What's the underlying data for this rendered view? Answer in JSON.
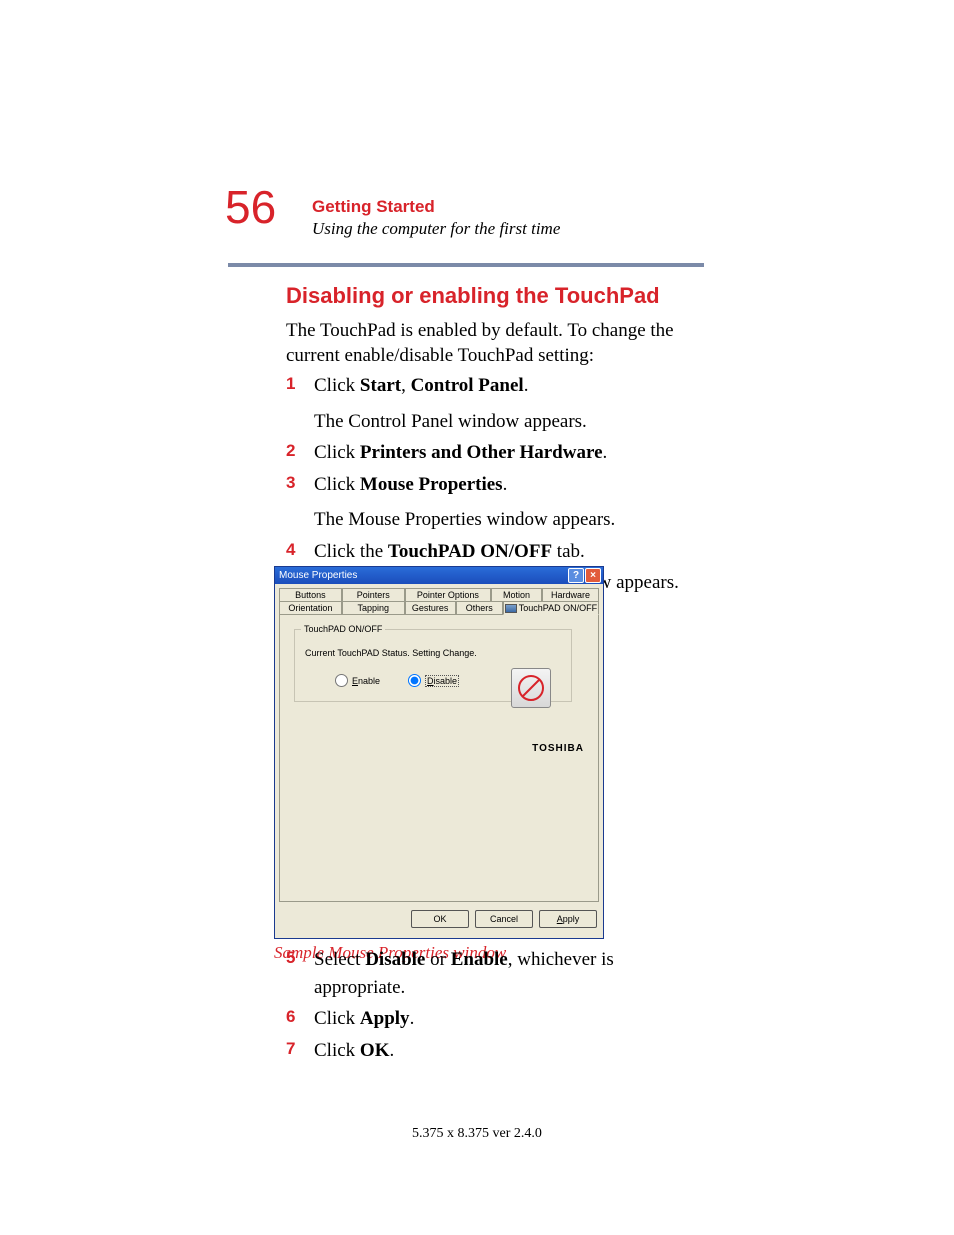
{
  "page_number": "56",
  "chapter": "Getting Started",
  "section": "Using the computer for the first time",
  "heading": "Disabling or enabling the TouchPad",
  "intro": "The TouchPad is enabled by default. To change the current enable/disable TouchPad setting:",
  "steps_a": [
    {
      "n": "1",
      "pre": "Click ",
      "b1": "Start",
      "mid": ", ",
      "b2": "Control Panel",
      "post": ".",
      "sub": "The Control Panel window appears."
    },
    {
      "n": "2",
      "pre": "Click ",
      "b1": "Printers and Other Hardware",
      "mid": "",
      "b2": "",
      "post": "."
    },
    {
      "n": "3",
      "pre": "Click ",
      "b1": "Mouse Properties",
      "mid": "",
      "b2": "",
      "post": ".",
      "sub": "The Mouse Properties window appears."
    },
    {
      "n": "4",
      "pre": "Click the ",
      "b1": "TouchPAD ON/OFF",
      "mid": " tab.",
      "b2": "",
      "post": "",
      "sub_outdent": "The TouchPAD ON/OFF tab view window appears."
    }
  ],
  "dialog": {
    "title": "Mouse Properties",
    "help": "?",
    "close": "×",
    "tabs_row1": [
      "Buttons",
      "Pointers",
      "Pointer Options",
      "Motion",
      "Hardware"
    ],
    "tabs_row2": [
      "Orientation",
      "Tapping",
      "Gestures",
      "Others",
      "TouchPAD ON/OFF"
    ],
    "fieldset_legend": "TouchPAD ON/OFF",
    "status": "Current TouchPAD Status. Setting Change.",
    "enable_prefix": "E",
    "enable_rest": "nable",
    "disable_prefix": "D",
    "disable_rest": "isable",
    "brand": "TOSHIBA",
    "ok": "OK",
    "cancel": "Cancel",
    "apply_prefix": "A",
    "apply_rest": "pply"
  },
  "caption": "Sample Mouse Properties window",
  "steps_b": [
    {
      "n": "5",
      "pre": "Select ",
      "b1": "Disable",
      "mid": " or ",
      "b2": "Enable",
      "post": ", whichever is appropriate."
    },
    {
      "n": "6",
      "pre": "Click ",
      "b1": "Apply",
      "mid": "",
      "b2": "",
      "post": "."
    },
    {
      "n": "7",
      "pre": "Click ",
      "b1": "OK",
      "mid": "",
      "b2": "",
      "post": "."
    }
  ],
  "footer": "5.375 x 8.375 ver 2.4.0"
}
